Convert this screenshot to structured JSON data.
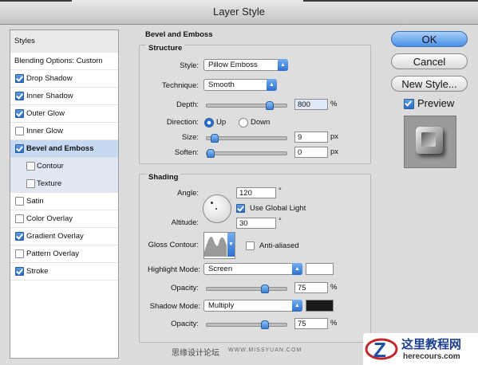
{
  "window": {
    "title": "Layer Style"
  },
  "sidebar": {
    "header": "Styles",
    "blending": "Blending Options: Custom",
    "items": [
      {
        "label": "Drop Shadow",
        "checked": true
      },
      {
        "label": "Inner Shadow",
        "checked": true
      },
      {
        "label": "Outer Glow",
        "checked": true
      },
      {
        "label": "Inner Glow",
        "checked": false
      },
      {
        "label": "Bevel and Emboss",
        "checked": true,
        "selected": true
      },
      {
        "label": "Contour",
        "checked": false,
        "sub": true
      },
      {
        "label": "Texture",
        "checked": false,
        "sub": true
      },
      {
        "label": "Satin",
        "checked": false
      },
      {
        "label": "Color Overlay",
        "checked": false
      },
      {
        "label": "Gradient Overlay",
        "checked": true
      },
      {
        "label": "Pattern Overlay",
        "checked": false
      },
      {
        "label": "Stroke",
        "checked": true
      }
    ]
  },
  "bevel": {
    "title": "Bevel and Emboss",
    "structure": {
      "title": "Structure",
      "style_label": "Style:",
      "style_value": "Pillow Emboss",
      "technique_label": "Technique:",
      "technique_value": "Smooth",
      "depth_label": "Depth:",
      "depth_value": "800",
      "depth_unit": "%",
      "depth_level": 0.82,
      "direction_label": "Direction:",
      "direction_up": "Up",
      "direction_down": "Down",
      "direction_selected": "Up",
      "size_label": "Size:",
      "size_value": "9",
      "size_unit": "px",
      "size_level": 0.06,
      "soften_label": "Soften:",
      "soften_value": "0",
      "soften_unit": "px",
      "soften_level": 0.0
    },
    "shading": {
      "title": "Shading",
      "angle_label": "Angle:",
      "angle_value": "120",
      "angle_unit": "°",
      "global_light_label": "Use Global Light",
      "global_light_checked": true,
      "altitude_label": "Altitude:",
      "altitude_value": "30",
      "altitude_unit": "°",
      "gloss_label": "Gloss Contour:",
      "antialias_label": "Anti-aliased",
      "antialias_checked": false,
      "highlight_mode_label": "Highlight Mode:",
      "highlight_mode_value": "Screen",
      "highlight_color": "#ffffff",
      "highlight_opacity_label": "Opacity:",
      "highlight_opacity_value": "75",
      "highlight_opacity_unit": "%",
      "highlight_opacity_level": 0.75,
      "shadow_mode_label": "Shadow Mode:",
      "shadow_mode_value": "Multiply",
      "shadow_color": "#1a1a1a",
      "shadow_opacity_label": "Opacity:",
      "shadow_opacity_value": "75",
      "shadow_opacity_unit": "%",
      "shadow_opacity_level": 0.75
    }
  },
  "buttons": {
    "ok": "OK",
    "cancel": "Cancel",
    "new_style": "New Style...",
    "preview": "Preview",
    "preview_checked": true
  },
  "watermark": {
    "site_a": "思缘设计论坛",
    "site_b": "WWW.MISSYUAN.COM",
    "brand": "这里教程网",
    "brand_url": "herecours.com"
  },
  "colors": {
    "accent": "#3a7bd5",
    "selection": "#c5d9f0"
  }
}
